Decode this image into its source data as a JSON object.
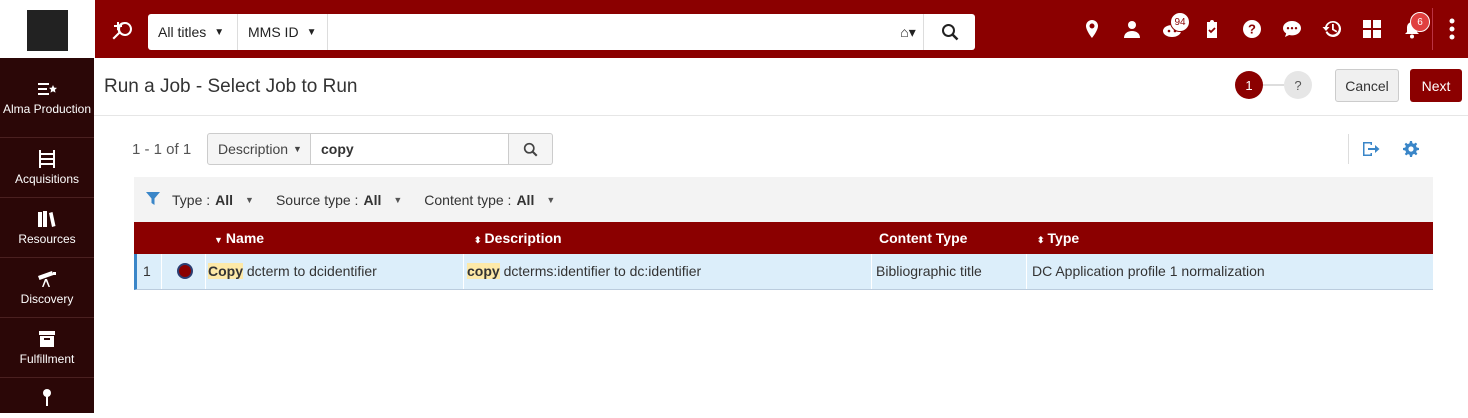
{
  "topbar": {
    "scope_select": "All titles",
    "field_select": "MMS ID",
    "search_value": "",
    "badges": {
      "tasks_count": "94",
      "notifications_count": "6"
    },
    "icons": [
      "add-search-icon",
      "home-icon",
      "search-icon",
      "location-pin-icon",
      "user-icon",
      "tasks-icon",
      "clipboard-icon",
      "help-icon",
      "chat-icon",
      "history-icon",
      "widgets-icon",
      "notifications-icon",
      "more-vertical-icon"
    ]
  },
  "sidebar": {
    "items": [
      {
        "label": "Alma Production",
        "icon": "alma-production-icon"
      },
      {
        "label": "Acquisitions",
        "icon": "acquisitions-icon"
      },
      {
        "label": "Resources",
        "icon": "resources-icon"
      },
      {
        "label": "Discovery",
        "icon": "discovery-icon"
      },
      {
        "label": "Fulfillment",
        "icon": "fulfillment-icon"
      }
    ]
  },
  "header": {
    "title": "Run a Job - Select Job to Run",
    "steps": [
      "1",
      "?"
    ],
    "cancel_label": "Cancel",
    "next_label": "Next"
  },
  "results": {
    "count_text": "1 - 1 of 1",
    "search_field": "Description",
    "search_value": "copy"
  },
  "filters": [
    {
      "label": "Type :",
      "value": "All"
    },
    {
      "label": "Source type :",
      "value": "All"
    },
    {
      "label": "Content type :",
      "value": "All"
    }
  ],
  "table": {
    "columns": [
      "Name",
      "Description",
      "Content Type",
      "Type"
    ],
    "rows": [
      {
        "index": "1",
        "name_highlight": "Copy",
        "name_rest": " dcterm to dcidentifier",
        "desc_highlight": "copy",
        "desc_rest": " dcterms:identifier to dc:identifier",
        "content_type": "Bibliographic title",
        "type": "DC Application profile 1 normalization"
      }
    ]
  },
  "colors": {
    "brand": "#8b0000",
    "sidebar": "#2b0707",
    "selected_row": "#dceefa",
    "highlight": "#fde9a8",
    "link_blue": "#3a86c8"
  }
}
